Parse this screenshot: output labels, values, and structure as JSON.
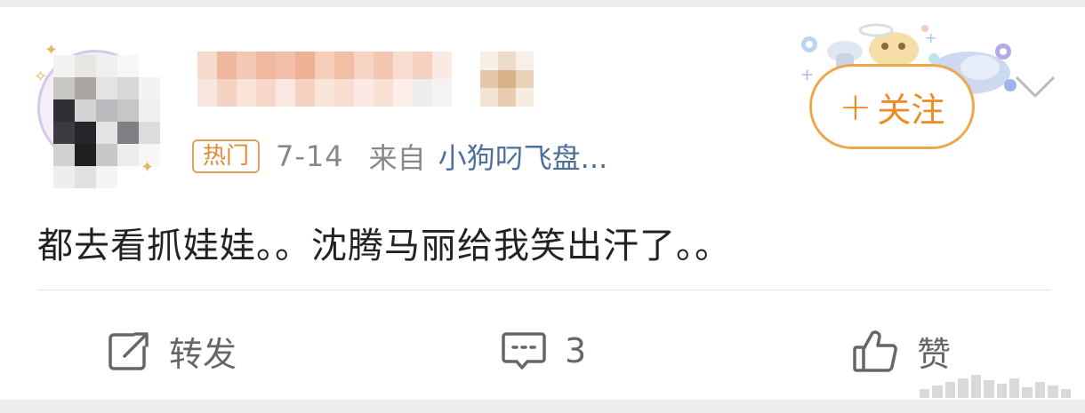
{
  "post": {
    "hot_tag": "热门",
    "date": "7-14",
    "from_label": "来自",
    "source": "小狗叼飞盘...",
    "text": "都去看抓娃娃。。沈腾马丽给我笑出汗了。。",
    "follow_label": "关注",
    "follow_plus": "+"
  },
  "actions": {
    "repost_label": "转发",
    "comment_count": "3",
    "like_label": "赞"
  },
  "colors": {
    "accent_orange": "#f08a24",
    "source_blue": "#4f6f9b",
    "meta_gray": "#888888",
    "text_dark": "#222222"
  },
  "icons": {
    "repost": "edit-share-icon",
    "comment": "comment-bubble-icon",
    "like": "thumbs-up-icon",
    "more": "chevron-down-icon"
  }
}
